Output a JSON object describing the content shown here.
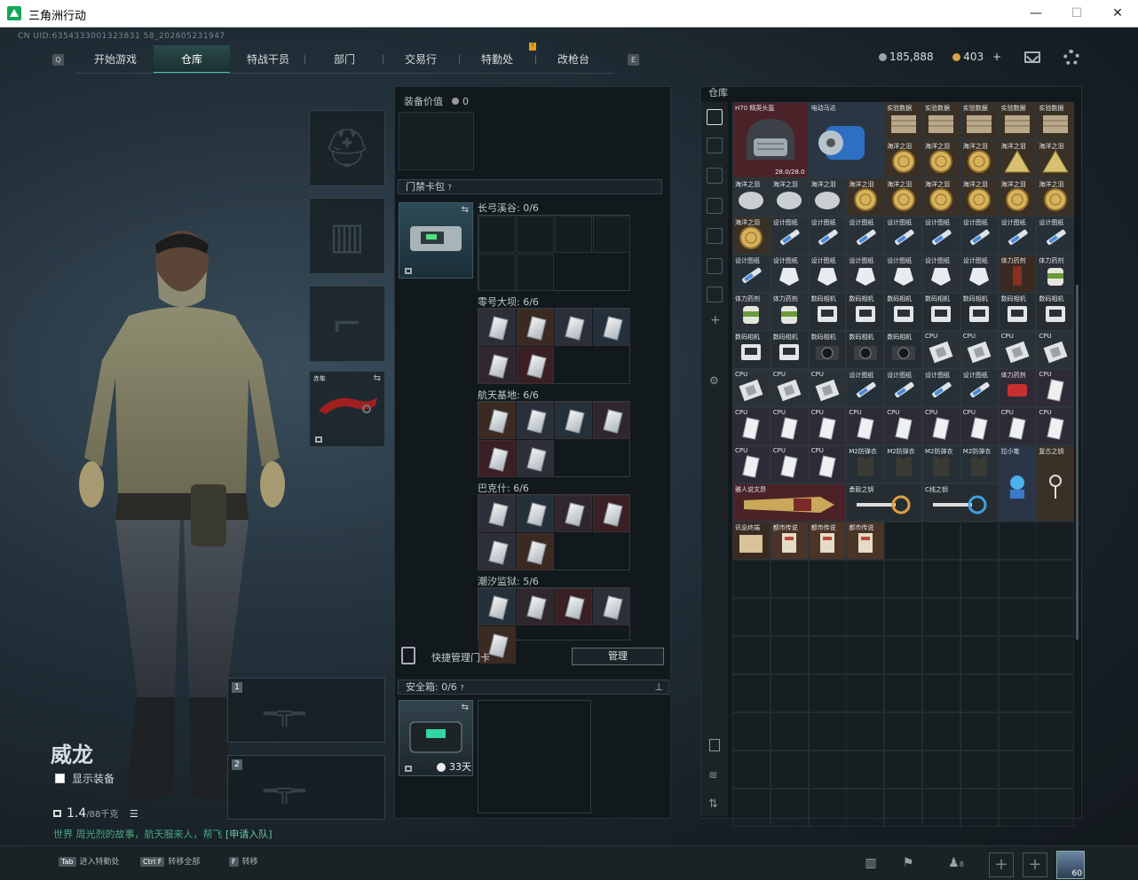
{
  "window": {
    "title": "三角洲行动",
    "minimize": "—",
    "maximize": "☐",
    "close": "✕"
  },
  "uid": "CN UID:6354333001323831 58_202605231947",
  "nav": {
    "tabs": [
      "开始游戏",
      "仓库",
      "特战干员",
      "部门",
      "交易行",
      "特勤处",
      "改枪台"
    ],
    "active": 1,
    "left_key": "Q",
    "right_key": "E"
  },
  "currency": {
    "coins": "185,888",
    "bonds": "403",
    "plus": "+",
    "coin_color": "#9aa5aa",
    "bond_color": "#d4a44a"
  },
  "character": {
    "name": "威龙",
    "show_equip": "显示装备",
    "weight": "1.4",
    "weight_unit": "/88千克",
    "hint_prefix": "世界",
    "hint": "周光烈的故事，航天服来人，帮飞",
    "hint_link": "[申请入队]"
  },
  "equipment": {
    "knife_label": "赤隼",
    "slot1": "1",
    "slot2": "2"
  },
  "middle": {
    "value_label": "装备价值",
    "value": "0",
    "keycard_title": "门禁卡包",
    "keycard_help": "?",
    "areas": [
      {
        "name": "长弓溪谷",
        "count": "0/6"
      },
      {
        "name": "零号大坝",
        "count": "6/6"
      },
      {
        "name": "航天基地",
        "count": "6/6"
      },
      {
        "name": "巴克什",
        "count": "6/6"
      },
      {
        "name": "潮汐监狱",
        "count": "5/6"
      }
    ],
    "quick_manage": "快捷管理门卡",
    "manage_btn": "管理",
    "safe_title": "安全箱",
    "safe_count": "0/6",
    "safe_help": "?",
    "safe_time": "33天"
  },
  "warehouse": {
    "title": "仓库",
    "items": [
      {
        "label": "H70 精英头盔",
        "sub": "28.0/28.0"
      },
      {
        "label": "电动马达"
      },
      {
        "label": "实验数据"
      },
      {
        "label": "海洋之泪"
      },
      {
        "label": "体力药剂"
      },
      {
        "label": "设计图纸"
      },
      {
        "label": "数码相机"
      },
      {
        "label": "CPU"
      },
      {
        "label": "M2防弹衣"
      },
      {
        "label": "拉小笔"
      },
      {
        "label": "复古之钥"
      },
      {
        "label": "雅人说文昂"
      },
      {
        "label": "勇毅之钥"
      },
      {
        "label": "C线之钥"
      },
      {
        "label": "讯息终端"
      },
      {
        "label": "都市传说"
      }
    ]
  },
  "bottom": {
    "keys": [
      {
        "key": "Tab",
        "label": "进入特勤处"
      },
      {
        "key": "Ctrl F",
        "label": "转移全部"
      },
      {
        "key": "F",
        "label": "转移"
      }
    ],
    "friends": "8",
    "level": "60"
  }
}
